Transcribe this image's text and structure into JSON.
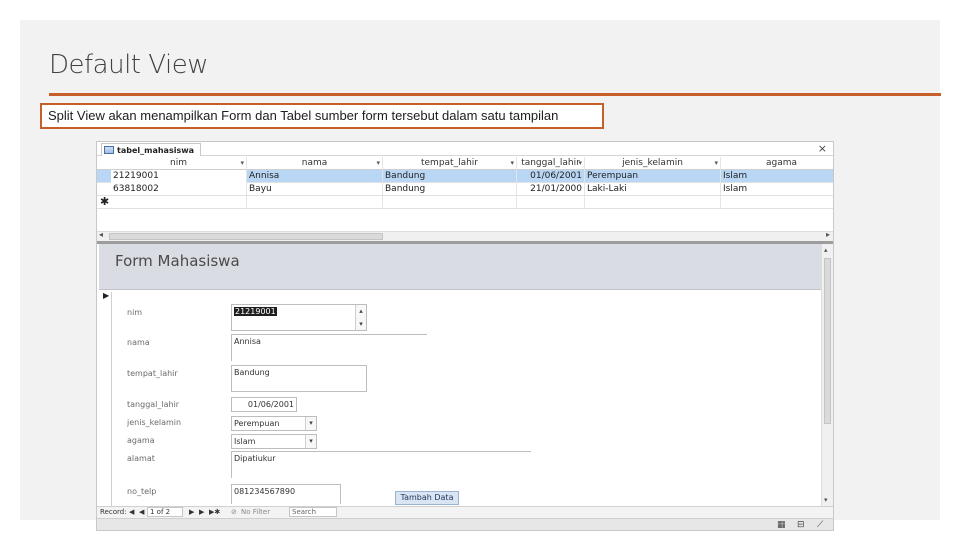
{
  "slide": {
    "title": "Default View",
    "caption": "Split View akan menampilkan Form dan Tabel sumber form tersebut dalam satu tampilan",
    "accent_color": "#c65f2a"
  },
  "access": {
    "tab_label": "tabel_mahasiswa",
    "close_glyph": "×",
    "datasheet": {
      "columns": [
        {
          "label": "nim",
          "sort": "▾"
        },
        {
          "label": "nama",
          "sort": "▾"
        },
        {
          "label": "tempat_lahir",
          "sort": "▾"
        },
        {
          "label": "tanggal_lahir",
          "sort": "▾"
        },
        {
          "label": "jenis_kelamin",
          "sort": "▾"
        },
        {
          "label": "agama",
          "sort": ""
        }
      ],
      "rows": [
        [
          "21219001",
          "Annisa",
          "Bandung",
          "01/06/2001",
          "Perempuan",
          "Islam"
        ],
        [
          "63818002",
          "Bayu",
          "Bandung",
          "21/01/2000",
          "Laki-Laki",
          "Islam"
        ]
      ],
      "new_row_marker": "✱"
    },
    "form": {
      "title": "Form Mahasiswa",
      "record_marker": "▶",
      "fields": {
        "nim": {
          "label": "nim",
          "value": "21219001"
        },
        "nama": {
          "label": "nama",
          "value": "Annisa"
        },
        "tempat_lahir": {
          "label": "tempat_lahir",
          "value": "Bandung"
        },
        "tanggal_lahir": {
          "label": "tanggal_lahir",
          "value": "01/06/2001"
        },
        "jenis_kelamin": {
          "label": "jenis_kelamin",
          "value": "Perempuan"
        },
        "agama": {
          "label": "agama",
          "value": "Islam"
        },
        "alamat": {
          "label": "alamat",
          "value": "Dipatiukur"
        },
        "no_telp": {
          "label": "no_telp",
          "value": "081234567890"
        }
      },
      "add_button": "Tambah Data"
    },
    "navigation": {
      "record_label": "Record:",
      "first": "◀",
      "prev": "◀",
      "position": "1 of 2",
      "next": "▶",
      "last": "▶",
      "new": "▶✱",
      "filter": "No Filter",
      "search_placeholder": "Search"
    }
  }
}
